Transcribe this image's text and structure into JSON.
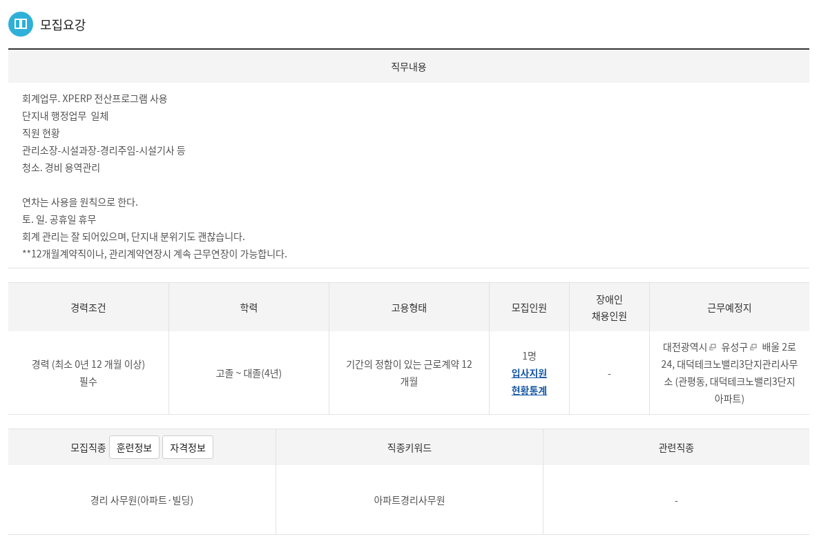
{
  "section_title": "모집요강",
  "duties": {
    "heading": "직무내용",
    "paragraphs": [
      [
        "회계업무. XPERP 전산프로그램 사용",
        "단지내 행정업무  일체",
        "직원 현황",
        "관리소장-시설과장-경리주임-시설기사 등",
        "청소. 경비 용역관리"
      ],
      [
        "연차는 사용을 원칙으로 한다.",
        "토. 일. 공휴일 휴무",
        "회계 관리는 잘 되어있으며, 단지내 분위기도 괜찮습니다.",
        "**12개월계약직이나, 관리계약연장시 계속 근무연장이 가능합니다."
      ]
    ]
  },
  "conditions": {
    "columns": [
      "경력조건",
      "학력",
      "고용형태",
      "모집인원",
      "장애인\n채용인원",
      "근무예정지"
    ],
    "experience": "경력 (최소 0년 12 개월 이상)\n필수",
    "education": "고졸 ~ 대졸(4년)",
    "employment_type": "기간의 정함이 있는 근로계약 12 개월",
    "headcount": "1명",
    "headcount_link": "입사지원 현황통계",
    "disabled_hiring": "-",
    "location": [
      {
        "kind": "link",
        "text": "대전광역시"
      },
      {
        "kind": "link",
        "text": "유성구"
      },
      {
        "kind": "text",
        "text": "배울 2로 24, 대덕테크노밸리3단지관리사무소 (관평동, 대덕테크노밸리3단지아파트)"
      }
    ]
  },
  "occupation": {
    "columns": [
      "모집직종",
      "직종키워드",
      "관련직종"
    ],
    "header_buttons": [
      "훈련정보",
      "자격정보"
    ],
    "cells": [
      "경리 사무원(아파트·빌딩)",
      "아파트경리사무원",
      "-"
    ]
  }
}
